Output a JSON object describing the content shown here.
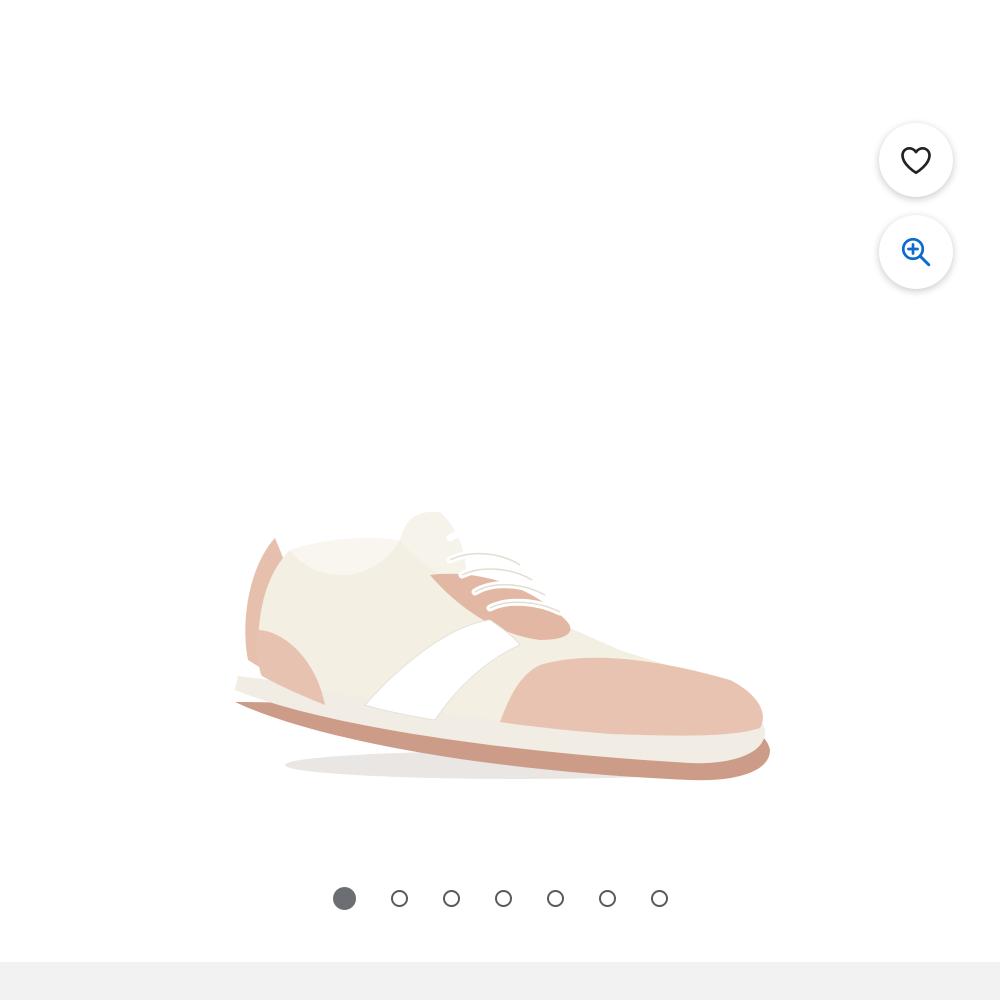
{
  "product": {
    "image_icon": "white-and-blush-pink-sneaker",
    "image_count": 7,
    "active_index": 0
  },
  "actions": {
    "favorite_icon": "heart-outline-icon",
    "zoom_icon": "zoom-in-icon"
  },
  "colors": {
    "accent": "#0a6cce",
    "active_dot": "#6b6f73",
    "inactive_dot_border": "#5a5a5a",
    "bottom_bar": "#f2f2f2"
  }
}
